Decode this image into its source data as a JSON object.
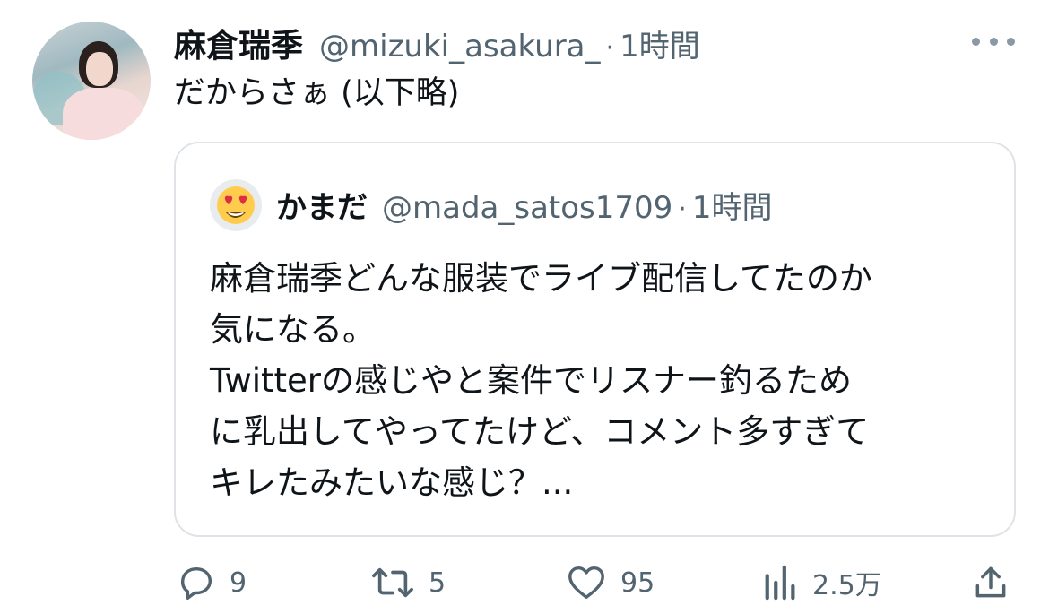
{
  "tweet": {
    "author_name": "麻倉瑞季",
    "author_handle": "@mizuki_asakura_",
    "separator": "·",
    "time": "1時間",
    "text": "だからさぁ (以下略)",
    "avatar_icon": "user-photo-avatar"
  },
  "quoted_tweet": {
    "author_name": "かまだ",
    "author_handle": "@mada_satos1709",
    "separator": "·",
    "time": "1時間",
    "avatar_icon": "heart-eyes-emoji-icon",
    "lines": [
      "麻倉瑞季どんな服装でライブ配信してたのか",
      "気になる。",
      "Twitterの感じやと案件でリスナー釣るため",
      "に乳出してやってたけど、コメント多すぎて",
      "キレたみたいな感じ？..."
    ]
  },
  "actions": {
    "reply_count": "9",
    "retweet_count": "5",
    "like_count": "95",
    "views_count": "2.5万"
  },
  "colors": {
    "text_primary": "#0f1419",
    "text_secondary": "#536471",
    "border": "#dfe3e7",
    "icon": "#536471"
  }
}
